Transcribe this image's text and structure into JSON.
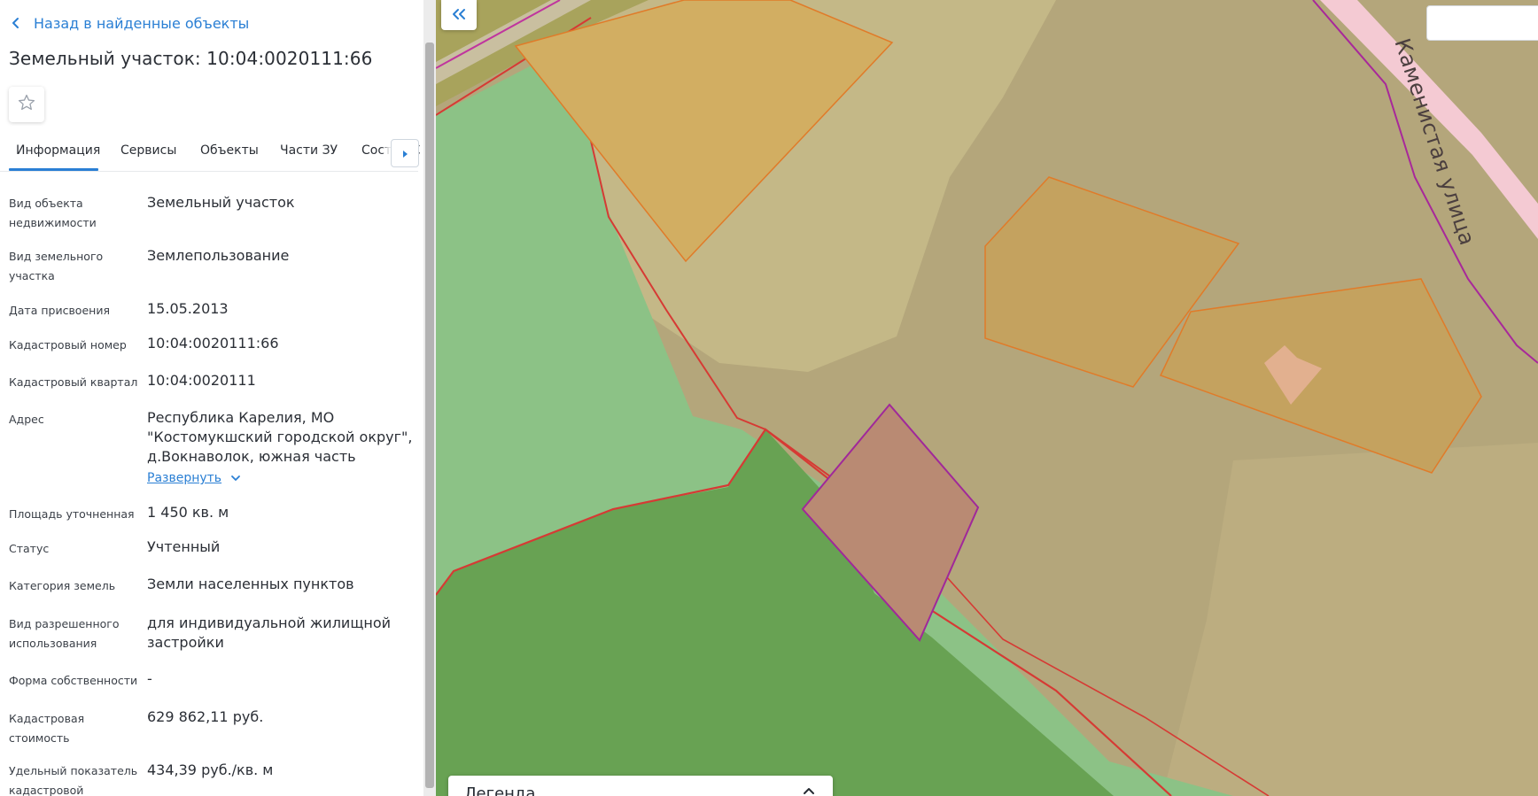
{
  "panel": {
    "back_link": "Назад в найденные объекты",
    "title": "Земельный участок: 10:04:0020111:66",
    "tabs": [
      "Информация",
      "Сервисы",
      "Объекты",
      "Части ЗУ",
      "Состав ЕЗП"
    ],
    "active_tab": "Информация",
    "rows": [
      {
        "label_lines": [
          "Вид объекта",
          "недвижимости"
        ],
        "value_lines": [
          "Земельный участок"
        ]
      },
      {
        "label_lines": [
          "Вид земельного",
          "участка"
        ],
        "value_lines": [
          "Землепользование"
        ]
      },
      {
        "label_lines": [
          "Дата присвоения"
        ],
        "value_lines": [
          "15.05.2013"
        ]
      },
      {
        "label_lines": [
          "Кадастровый номер"
        ],
        "value_lines": [
          "10:04:0020111:66"
        ]
      },
      {
        "label_lines": [
          "Кадастровый квартал"
        ],
        "value_lines": [
          "10:04:0020111"
        ]
      },
      {
        "label_lines": [
          "Адрес"
        ],
        "value_lines": [
          "Республика Карелия, МО",
          "\"Костомукшский городской округ\",",
          "д.Вокнаволок, южная часть"
        ]
      },
      {
        "label_lines": [
          "Площадь уточненная"
        ],
        "value_lines": [
          "1 450 кв. м"
        ]
      },
      {
        "label_lines": [
          "Статус"
        ],
        "value_lines": [
          "Учтенный"
        ]
      },
      {
        "label_lines": [
          "Категория земель"
        ],
        "value_lines": [
          "Земли населенных пунктов"
        ]
      },
      {
        "label_lines": [
          "Вид разрешенного",
          "использования"
        ],
        "value_lines": [
          "для индивидуальной жилищной",
          "застройки"
        ]
      },
      {
        "label_lines": [
          "Форма собственности"
        ],
        "value_lines": [
          "-"
        ]
      },
      {
        "label_lines": [
          "Кадастровая",
          "стоимость"
        ],
        "value_lines": [
          "629 862,11 руб."
        ]
      },
      {
        "label_lines": [
          "Удельный показатель",
          "кадастровой"
        ],
        "value_lines": [
          "434,39 руб./кв. м"
        ]
      }
    ],
    "expand_label": "Развернуть"
  },
  "map": {
    "street_label": "Каменистая улица",
    "legend_title": "Легенда",
    "colors": {
      "accent": "#2a7fd4",
      "parcel_border_red": "#d63a34",
      "parcel_border_purple": "#a0289a",
      "building_orange": "#e07b29",
      "selected_parcel": "#b98a73",
      "forest_dark": "#68a253",
      "forest_light": "#8cc286",
      "terrain": "#b4a67b"
    }
  },
  "icons": {
    "back": "chevron-left-icon",
    "favorite": "star-outline-icon",
    "tab_scroll": "caret-right-icon",
    "collapse_panel": "double-chevron-left-icon",
    "expand": "chevron-down-icon",
    "legend_toggle": "chevron-up-icon"
  }
}
